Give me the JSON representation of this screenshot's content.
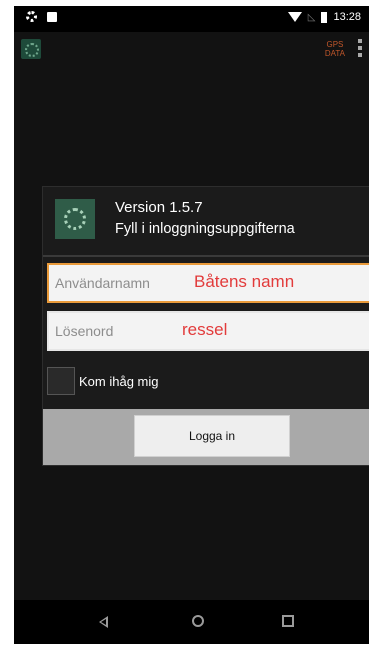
{
  "status_bar": {
    "time": "13:28",
    "icons": [
      "settings-icon",
      "notification-icon",
      "wifi-icon",
      "signal-icon",
      "battery-icon"
    ]
  },
  "app_bar": {
    "gps_label_line1": "GPS",
    "gps_label_line2": "DATA"
  },
  "dialog": {
    "version": "Version 1.5.7",
    "subtitle": "Fyll i inloggningsuppgifterna",
    "username": {
      "placeholder": "Användarnamn",
      "value": "",
      "annotation": "Båtens namn"
    },
    "password": {
      "placeholder": "Lösenord",
      "value": "",
      "annotation": "ressel"
    },
    "remember_label": "Kom ihåg mig",
    "remember_checked": false,
    "login_button": "Logga in"
  },
  "colors": {
    "focus_border": "#e99a3a",
    "annotation": "#e23b3b",
    "gps_text": "#c0562a",
    "logo_green": "#2f5c48"
  }
}
